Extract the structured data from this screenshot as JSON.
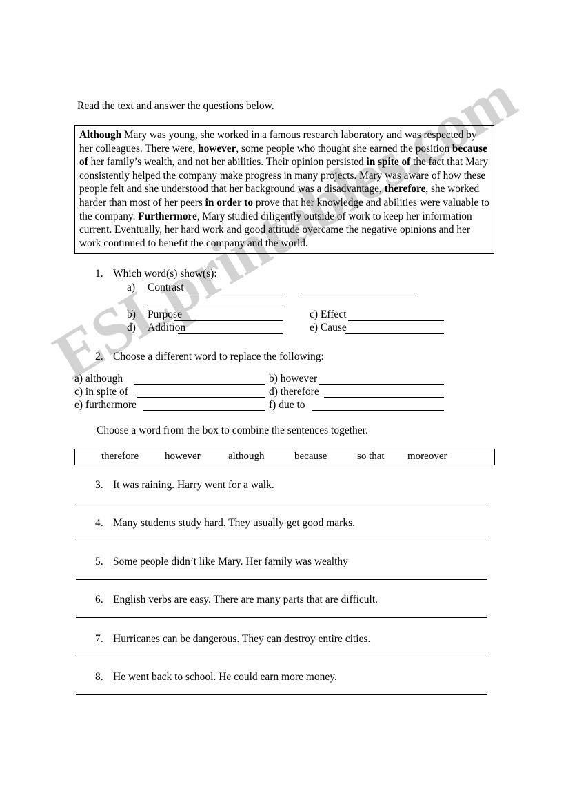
{
  "document": {
    "intro": "Read the text and answer the questions below.",
    "watermark": "ESLprintables.com"
  },
  "passage": {
    "segments": [
      {
        "text": "Although",
        "bold": true
      },
      {
        "text": " Mary was young, she worked in a famous research laboratory and was respected by her colleagues.  There were, ",
        "bold": false
      },
      {
        "text": "however",
        "bold": true
      },
      {
        "text": ", some people who thought she earned the position ",
        "bold": false
      },
      {
        "text": "because of",
        "bold": true
      },
      {
        "text": " her family’s wealth, and not her abilities.  Their opinion persisted ",
        "bold": false
      },
      {
        "text": "in spite of",
        "bold": true
      },
      {
        "text": " the fact that Mary consistently helped the company make progress in many projects. Mary was aware of how these people felt and she understood that her background was a disadvantage, ",
        "bold": false
      },
      {
        "text": "therefore",
        "bold": true
      },
      {
        "text": ", she worked harder than most of her peers ",
        "bold": false
      },
      {
        "text": "in order to",
        "bold": true
      },
      {
        "text": " prove that her knowledge and abilities were valuable to the company.  ",
        "bold": false
      },
      {
        "text": "Furthermore",
        "bold": true
      },
      {
        "text": ", Mary studied diligently outside of work to keep her information current.  Eventually, her hard work and good attitude overcame the negative opinions and her work continued to benefit the company and the world.",
        "bold": false
      }
    ]
  },
  "question1": {
    "number": "1.",
    "prompt": "Which word(s) show(s):",
    "items": [
      {
        "label": "a)",
        "text": "Contrast"
      },
      {
        "label": "b)",
        "text": "Purpose"
      },
      {
        "label": "c)",
        "text": "Effect"
      },
      {
        "label": "d)",
        "text": "Addition"
      },
      {
        "label": "e)",
        "text": "Cause"
      }
    ]
  },
  "question2": {
    "number": "2.",
    "prompt": "Choose a different word to replace the following:",
    "items": [
      {
        "label": "a)",
        "text": "although"
      },
      {
        "label": "b)",
        "text": "however"
      },
      {
        "label": "c)",
        "text": "in spite of"
      },
      {
        "label": "d)",
        "text": "therefore"
      },
      {
        "label": "e)",
        "text": "furthermore"
      },
      {
        "label": "f)",
        "text": "due to"
      }
    ]
  },
  "wordbank": {
    "instruction": "Choose a word from the box to combine the sentences together.",
    "words": [
      "therefore",
      "however",
      "although",
      "because",
      "so that",
      "moreover"
    ]
  },
  "sentences": [
    {
      "number": "3.",
      "text": "It was raining.  Harry went for a walk."
    },
    {
      "number": "4.",
      "text": "Many students study hard.  They usually get good marks."
    },
    {
      "number": "5.",
      "text": "Some people didn’t like Mary.  Her family was wealthy"
    },
    {
      "number": "6.",
      "text": "English verbs are easy.  There are many parts that are difficult."
    },
    {
      "number": "7.",
      "text": "Hurricanes can be dangerous.  They can destroy entire cities."
    },
    {
      "number": "8.",
      "text": "He went back to school.  He could earn more money."
    }
  ]
}
